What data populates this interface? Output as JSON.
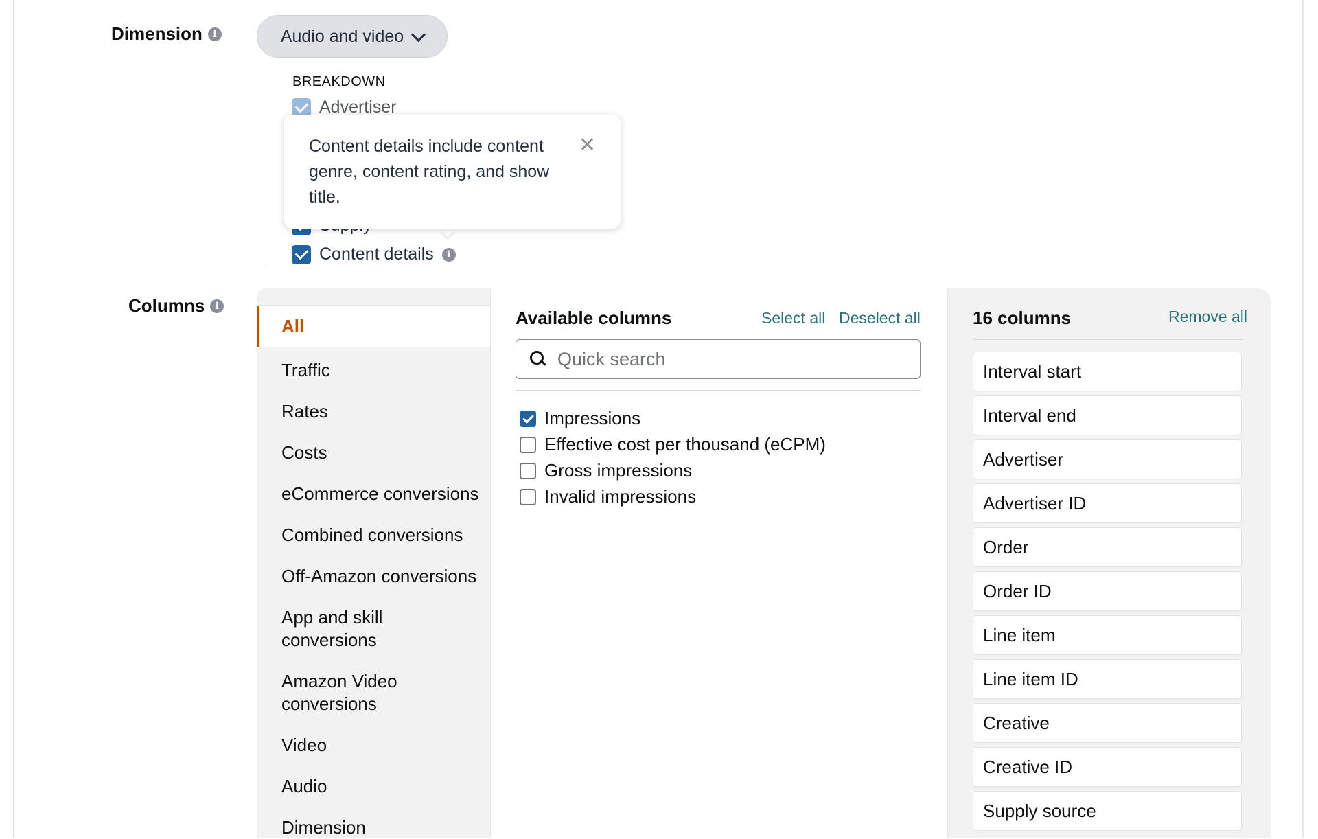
{
  "dimension": {
    "label": "Dimension",
    "selected": "Audio and video",
    "breakdown_title": "BREAKDOWN",
    "breakdown_items": [
      {
        "label": "Advertiser",
        "checked": true,
        "disabled": true
      },
      {
        "label": "Supply",
        "checked": true,
        "disabled": false
      },
      {
        "label": "Content details",
        "checked": true,
        "disabled": false
      }
    ],
    "tooltip": "Content details include content genre, content rating, and show title."
  },
  "columns": {
    "label": "Columns",
    "categories": [
      {
        "label": "All",
        "active": true
      },
      {
        "label": "Traffic"
      },
      {
        "label": "Rates"
      },
      {
        "label": "Costs"
      },
      {
        "label": "eCommerce conversions"
      },
      {
        "label": "Combined conversions"
      },
      {
        "label": "Off-Amazon conversions"
      },
      {
        "label": "App and skill conversions"
      },
      {
        "label": "Amazon Video conversions"
      },
      {
        "label": "Video"
      },
      {
        "label": "Audio"
      },
      {
        "label": "Dimension"
      }
    ],
    "available": {
      "title": "Available columns",
      "select_all": "Select all",
      "deselect_all": "Deselect all",
      "search_placeholder": "Quick search",
      "search_value": "",
      "items": [
        {
          "label": "Impressions",
          "checked": true
        },
        {
          "label": "Effective cost per thousand (eCPM)",
          "checked": false
        },
        {
          "label": "Gross impressions",
          "checked": false
        },
        {
          "label": "Invalid impressions",
          "checked": false
        }
      ]
    },
    "selected": {
      "title": "16 columns",
      "remove_all": "Remove all",
      "items": [
        "Interval start",
        "Interval end",
        "Advertiser",
        "Advertiser ID",
        "Order",
        "Order ID",
        "Line item",
        "Line item ID",
        "Creative",
        "Creative ID",
        "Supply source"
      ]
    }
  },
  "colors": {
    "accent": "#c45500",
    "checkbox": "#2162a1",
    "link": "#2a7378"
  }
}
